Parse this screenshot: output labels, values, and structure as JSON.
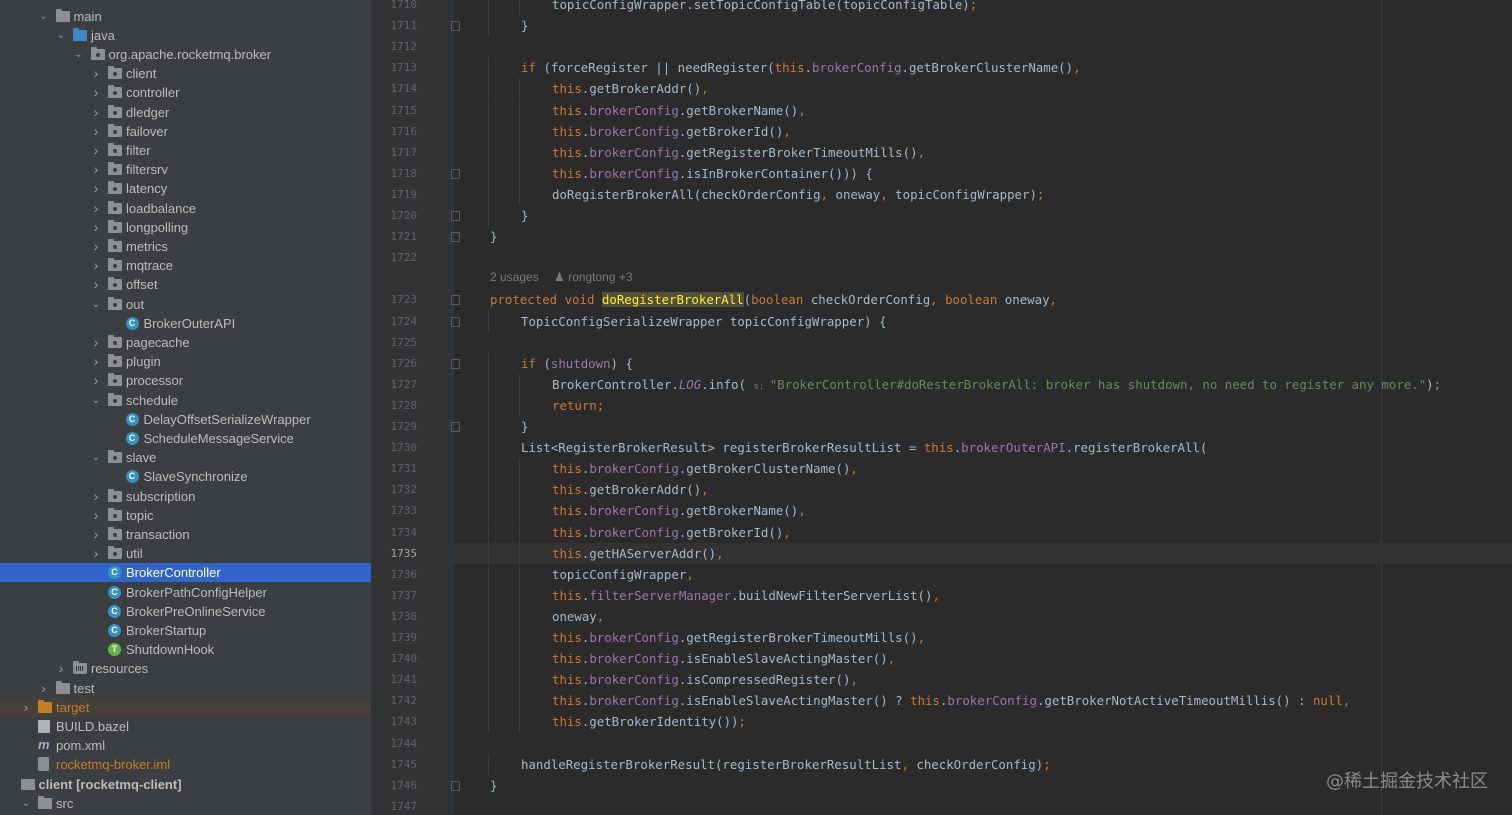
{
  "project_tree": {
    "items": [
      {
        "label": "main",
        "depth": 1,
        "arrow": "down",
        "icon": "folder-icon"
      },
      {
        "label": "java",
        "depth": 2,
        "arrow": "down",
        "icon": "source-folder-icon"
      },
      {
        "label": "org.apache.rocketmq.broker",
        "depth": 3,
        "arrow": "down",
        "icon": "package-icon"
      },
      {
        "label": "client",
        "depth": 4,
        "arrow": "right",
        "icon": "package-icon"
      },
      {
        "label": "controller",
        "depth": 4,
        "arrow": "right",
        "icon": "package-icon"
      },
      {
        "label": "dledger",
        "depth": 4,
        "arrow": "right",
        "icon": "package-icon"
      },
      {
        "label": "failover",
        "depth": 4,
        "arrow": "right",
        "icon": "package-icon"
      },
      {
        "label": "filter",
        "depth": 4,
        "arrow": "right",
        "icon": "package-icon"
      },
      {
        "label": "filtersrv",
        "depth": 4,
        "arrow": "right",
        "icon": "package-icon"
      },
      {
        "label": "latency",
        "depth": 4,
        "arrow": "right",
        "icon": "package-icon"
      },
      {
        "label": "loadbalance",
        "depth": 4,
        "arrow": "right",
        "icon": "package-icon"
      },
      {
        "label": "longpolling",
        "depth": 4,
        "arrow": "right",
        "icon": "package-icon"
      },
      {
        "label": "metrics",
        "depth": 4,
        "arrow": "right",
        "icon": "package-icon"
      },
      {
        "label": "mqtrace",
        "depth": 4,
        "arrow": "right",
        "icon": "package-icon"
      },
      {
        "label": "offset",
        "depth": 4,
        "arrow": "right",
        "icon": "package-icon"
      },
      {
        "label": "out",
        "depth": 4,
        "arrow": "down",
        "icon": "package-icon"
      },
      {
        "label": "BrokerOuterAPI",
        "depth": 5,
        "arrow": "",
        "icon": "class-icon"
      },
      {
        "label": "pagecache",
        "depth": 4,
        "arrow": "right",
        "icon": "package-icon"
      },
      {
        "label": "plugin",
        "depth": 4,
        "arrow": "right",
        "icon": "package-icon"
      },
      {
        "label": "processor",
        "depth": 4,
        "arrow": "right",
        "icon": "package-icon"
      },
      {
        "label": "schedule",
        "depth": 4,
        "arrow": "down",
        "icon": "package-icon"
      },
      {
        "label": "DelayOffsetSerializeWrapper",
        "depth": 5,
        "arrow": "",
        "icon": "class-icon"
      },
      {
        "label": "ScheduleMessageService",
        "depth": 5,
        "arrow": "",
        "icon": "class-icon"
      },
      {
        "label": "slave",
        "depth": 4,
        "arrow": "down",
        "icon": "package-icon"
      },
      {
        "label": "SlaveSynchronize",
        "depth": 5,
        "arrow": "",
        "icon": "class-icon"
      },
      {
        "label": "subscription",
        "depth": 4,
        "arrow": "right",
        "icon": "package-icon"
      },
      {
        "label": "topic",
        "depth": 4,
        "arrow": "right",
        "icon": "package-icon"
      },
      {
        "label": "transaction",
        "depth": 4,
        "arrow": "right",
        "icon": "package-icon"
      },
      {
        "label": "util",
        "depth": 4,
        "arrow": "right",
        "icon": "package-icon"
      },
      {
        "label": "BrokerController",
        "depth": 4,
        "arrow": "",
        "icon": "class-icon",
        "selected": true
      },
      {
        "label": "BrokerPathConfigHelper",
        "depth": 4,
        "arrow": "",
        "icon": "class-icon"
      },
      {
        "label": "BrokerPreOnlineService",
        "depth": 4,
        "arrow": "",
        "icon": "class-icon"
      },
      {
        "label": "BrokerStartup",
        "depth": 4,
        "arrow": "",
        "icon": "class-icon"
      },
      {
        "label": "ShutdownHook",
        "depth": 4,
        "arrow": "",
        "icon": "thread-class-icon"
      },
      {
        "label": "resources",
        "depth": 2,
        "arrow": "right",
        "icon": "resources-folder-icon"
      },
      {
        "label": "test",
        "depth": 1,
        "arrow": "right",
        "icon": "folder-icon"
      },
      {
        "label": "target",
        "depth": 0,
        "arrow": "right",
        "icon": "excluded-folder-icon",
        "excluded": true
      },
      {
        "label": "BUILD.bazel",
        "depth": 0,
        "arrow": "",
        "icon": "bazel-file-icon"
      },
      {
        "label": "pom.xml",
        "depth": 0,
        "arrow": "",
        "icon": "maven-file-icon"
      },
      {
        "label": "rocketmq-broker.iml",
        "depth": 0,
        "arrow": "",
        "icon": "iml-file-icon",
        "orange": true
      },
      {
        "label": "client [rocketmq-client]",
        "depth": -1,
        "arrow": "",
        "icon": "module-icon",
        "bold": true
      },
      {
        "label": "src",
        "depth": 0,
        "arrow": "down",
        "icon": "folder-icon"
      }
    ]
  },
  "editor": {
    "current_line": "1735",
    "usages": {
      "count": "2 usages",
      "authors": "rongtong +3"
    },
    "lines": [
      {
        "n": "1710",
        "indent": 2,
        "code": [
          [
            "id",
            "topicConfigWrapper."
          ],
          [
            "id",
            "setTopicConfigTable(topicConfigTable)"
          ],
          [
            "kw",
            ";"
          ]
        ]
      },
      {
        "n": "1711",
        "indent": 1,
        "code": [
          [
            "id",
            "}"
          ]
        ]
      },
      {
        "n": "1712",
        "indent": 0,
        "code": []
      },
      {
        "n": "1713",
        "indent": 1,
        "code": [
          [
            "kw",
            "if "
          ],
          [
            "id",
            "(forceRegister || needRegister("
          ],
          [
            "kw",
            "this"
          ],
          [
            "id",
            "."
          ],
          [
            "fld",
            "brokerConfig"
          ],
          [
            "id",
            ".getBrokerClusterName()"
          ],
          [
            "kw",
            ","
          ]
        ]
      },
      {
        "n": "1714",
        "indent": 2,
        "code": [
          [
            "kw",
            "this"
          ],
          [
            "id",
            ".getBrokerAddr()"
          ],
          [
            "kw",
            ","
          ]
        ]
      },
      {
        "n": "1715",
        "indent": 2,
        "code": [
          [
            "kw",
            "this"
          ],
          [
            "id",
            "."
          ],
          [
            "fld",
            "brokerConfig"
          ],
          [
            "id",
            ".getBrokerName()"
          ],
          [
            "kw",
            ","
          ]
        ]
      },
      {
        "n": "1716",
        "indent": 2,
        "code": [
          [
            "kw",
            "this"
          ],
          [
            "id",
            "."
          ],
          [
            "fld",
            "brokerConfig"
          ],
          [
            "id",
            ".getBrokerId()"
          ],
          [
            "kw",
            ","
          ]
        ]
      },
      {
        "n": "1717",
        "indent": 2,
        "code": [
          [
            "kw",
            "this"
          ],
          [
            "id",
            "."
          ],
          [
            "fld",
            "brokerConfig"
          ],
          [
            "id",
            ".getRegisterBrokerTimeoutMills()"
          ],
          [
            "kw",
            ","
          ]
        ]
      },
      {
        "n": "1718",
        "indent": 2,
        "code": [
          [
            "kw",
            "this"
          ],
          [
            "id",
            "."
          ],
          [
            "fld",
            "brokerConfig"
          ],
          [
            "id",
            ".isInBrokerContainer())) {"
          ]
        ]
      },
      {
        "n": "1719",
        "indent": 2,
        "code": [
          [
            "id",
            "doRegisterBrokerAll(checkOrderConfig"
          ],
          [
            "kw",
            ", "
          ],
          [
            "id",
            "oneway"
          ],
          [
            "kw",
            ", "
          ],
          [
            "id",
            "topicConfigWrapper)"
          ],
          [
            "kw",
            ";"
          ]
        ]
      },
      {
        "n": "1720",
        "indent": 1,
        "code": [
          [
            "id",
            "}"
          ]
        ]
      },
      {
        "n": "1721",
        "indent": 0,
        "code": [
          [
            "id",
            "}"
          ]
        ]
      },
      {
        "n": "1722",
        "indent": 0,
        "code": []
      },
      {
        "n": "",
        "indent": 0,
        "code": []
      },
      {
        "n": "1723",
        "indent": 0,
        "code": [
          [
            "kw",
            "protected void "
          ],
          [
            "hl",
            "doRegisterBrokerAll"
          ],
          [
            "id",
            "("
          ],
          [
            "kw",
            "boolean "
          ],
          [
            "id",
            "checkOrderConfig"
          ],
          [
            "kw",
            ", boolean "
          ],
          [
            "id",
            "oneway"
          ],
          [
            "kw",
            ","
          ]
        ]
      },
      {
        "n": "1724",
        "indent": 1,
        "code": [
          [
            "id",
            "TopicConfigSerializeWrapper topicConfigWrapper) {"
          ]
        ]
      },
      {
        "n": "1725",
        "indent": 0,
        "code": []
      },
      {
        "n": "1726",
        "indent": 1,
        "code": [
          [
            "kw",
            "if "
          ],
          [
            "id",
            "("
          ],
          [
            "fld",
            "shutdown"
          ],
          [
            "id",
            ") {"
          ]
        ]
      },
      {
        "n": "1727",
        "indent": 2,
        "code": [
          [
            "id",
            "BrokerController."
          ],
          [
            "static",
            "LOG"
          ],
          [
            "id",
            ".info( "
          ],
          [
            "hint",
            "s: "
          ],
          [
            "str",
            "\"BrokerController#doResterBrokerAll: broker has shutdown, no need to register any more.\""
          ],
          [
            "id",
            ")"
          ],
          [
            "kw",
            ";"
          ]
        ]
      },
      {
        "n": "1728",
        "indent": 2,
        "code": [
          [
            "kw",
            "return;"
          ]
        ]
      },
      {
        "n": "1729",
        "indent": 1,
        "code": [
          [
            "id",
            "}"
          ]
        ]
      },
      {
        "n": "1730",
        "indent": 1,
        "code": [
          [
            "id",
            "List<RegisterBrokerResult> registerBrokerResultList = "
          ],
          [
            "kw",
            "this"
          ],
          [
            "id",
            "."
          ],
          [
            "fld",
            "brokerOuterAPI"
          ],
          [
            "id",
            ".registerBrokerAll("
          ]
        ]
      },
      {
        "n": "1731",
        "indent": 2,
        "code": [
          [
            "kw",
            "this"
          ],
          [
            "id",
            "."
          ],
          [
            "fld",
            "brokerConfig"
          ],
          [
            "id",
            ".getBrokerClusterName()"
          ],
          [
            "kw",
            ","
          ]
        ]
      },
      {
        "n": "1732",
        "indent": 2,
        "code": [
          [
            "kw",
            "this"
          ],
          [
            "id",
            ".getBrokerAddr()"
          ],
          [
            "kw",
            ","
          ]
        ]
      },
      {
        "n": "1733",
        "indent": 2,
        "code": [
          [
            "kw",
            "this"
          ],
          [
            "id",
            "."
          ],
          [
            "fld",
            "brokerConfig"
          ],
          [
            "id",
            ".getBrokerName()"
          ],
          [
            "kw",
            ","
          ]
        ]
      },
      {
        "n": "1734",
        "indent": 2,
        "code": [
          [
            "kw",
            "this"
          ],
          [
            "id",
            "."
          ],
          [
            "fld",
            "brokerConfig"
          ],
          [
            "id",
            ".getBrokerId()"
          ],
          [
            "kw",
            ","
          ]
        ]
      },
      {
        "n": "1735",
        "indent": 2,
        "code": [
          [
            "kw",
            "this"
          ],
          [
            "id",
            ".getHAServerAddr()"
          ],
          [
            "kw",
            ","
          ]
        ]
      },
      {
        "n": "1736",
        "indent": 2,
        "code": [
          [
            "id",
            "topicConfigWrapper"
          ],
          [
            "kw",
            ","
          ]
        ]
      },
      {
        "n": "1737",
        "indent": 2,
        "code": [
          [
            "kw",
            "this"
          ],
          [
            "id",
            "."
          ],
          [
            "fld",
            "filterServerManager"
          ],
          [
            "id",
            ".buildNewFilterServerList()"
          ],
          [
            "kw",
            ","
          ]
        ]
      },
      {
        "n": "1738",
        "indent": 2,
        "code": [
          [
            "id",
            "oneway"
          ],
          [
            "kw",
            ","
          ]
        ]
      },
      {
        "n": "1739",
        "indent": 2,
        "code": [
          [
            "kw",
            "this"
          ],
          [
            "id",
            "."
          ],
          [
            "fld",
            "brokerConfig"
          ],
          [
            "id",
            ".getRegisterBrokerTimeoutMills()"
          ],
          [
            "kw",
            ","
          ]
        ]
      },
      {
        "n": "1740",
        "indent": 2,
        "code": [
          [
            "kw",
            "this"
          ],
          [
            "id",
            "."
          ],
          [
            "fld",
            "brokerConfig"
          ],
          [
            "id",
            ".isEnableSlaveActingMaster()"
          ],
          [
            "kw",
            ","
          ]
        ]
      },
      {
        "n": "1741",
        "indent": 2,
        "code": [
          [
            "kw",
            "this"
          ],
          [
            "id",
            "."
          ],
          [
            "fld",
            "brokerConfig"
          ],
          [
            "id",
            ".isCompressedRegister()"
          ],
          [
            "kw",
            ","
          ]
        ]
      },
      {
        "n": "1742",
        "indent": 2,
        "code": [
          [
            "kw",
            "this"
          ],
          [
            "id",
            "."
          ],
          [
            "fld",
            "brokerConfig"
          ],
          [
            "id",
            ".isEnableSlaveActingMaster() ? "
          ],
          [
            "kw",
            "this"
          ],
          [
            "id",
            "."
          ],
          [
            "fld",
            "brokerConfig"
          ],
          [
            "id",
            ".getBrokerNotActiveTimeoutMillis() : "
          ],
          [
            "kw",
            "null,"
          ]
        ]
      },
      {
        "n": "1743",
        "indent": 2,
        "code": [
          [
            "kw",
            "this"
          ],
          [
            "id",
            ".getBrokerIdentity())"
          ],
          [
            "kw",
            ";"
          ]
        ]
      },
      {
        "n": "1744",
        "indent": 0,
        "code": []
      },
      {
        "n": "1745",
        "indent": 1,
        "code": [
          [
            "id",
            "handleRegisterBrokerResult(registerBrokerResultList"
          ],
          [
            "kw",
            ", "
          ],
          [
            "id",
            "checkOrderConfig)"
          ],
          [
            "kw",
            ";"
          ]
        ]
      },
      {
        "n": "1746",
        "indent": 0,
        "code": [
          [
            "id",
            "}"
          ]
        ]
      },
      {
        "n": "1747",
        "indent": 0,
        "code": []
      }
    ]
  },
  "watermark": "@稀土掘金技术社区"
}
